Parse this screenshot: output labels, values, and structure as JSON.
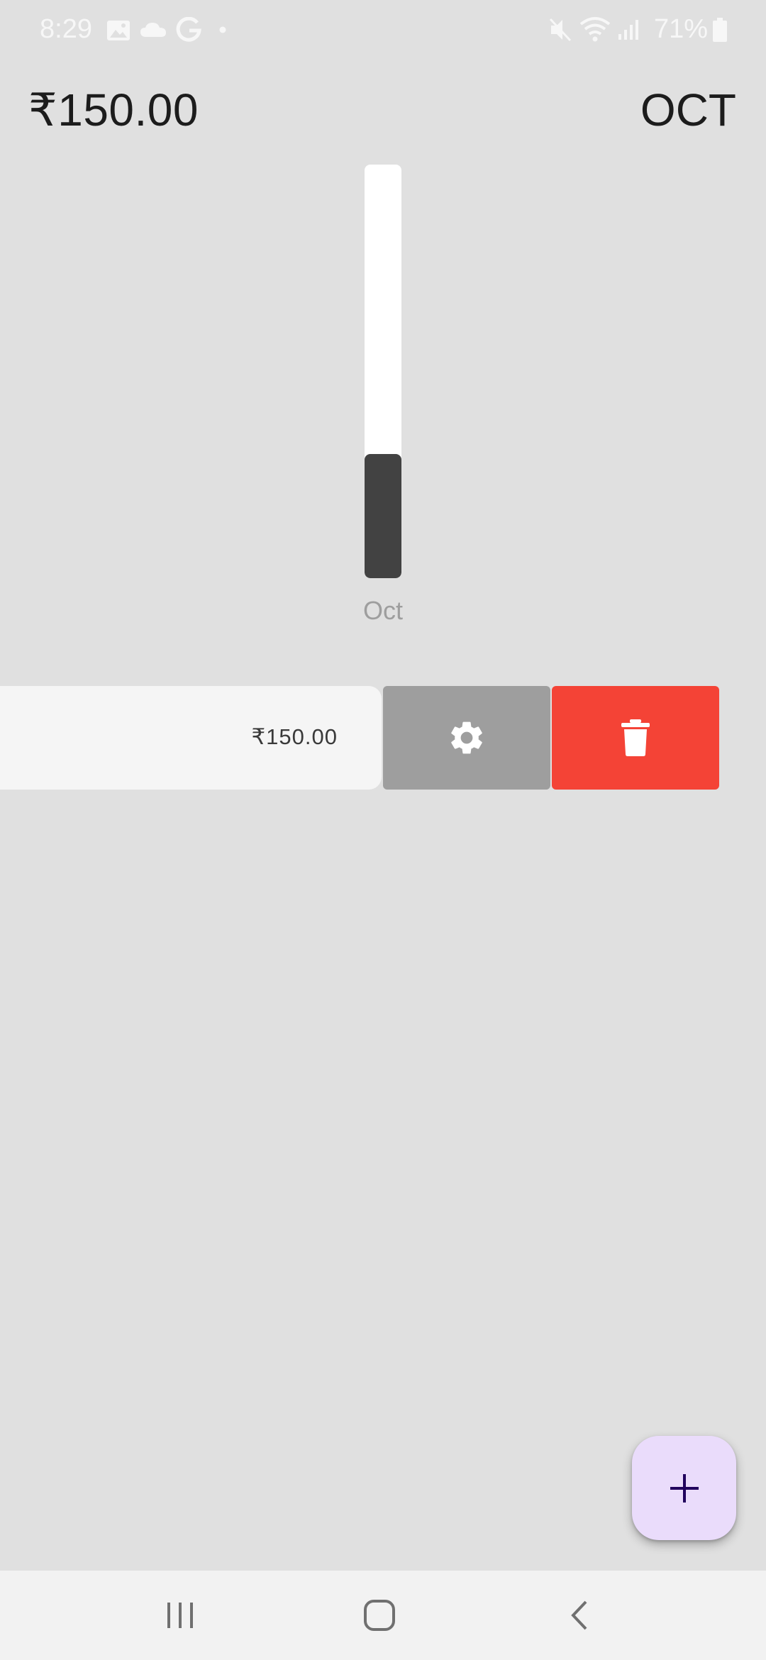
{
  "status_bar": {
    "time": "8:29",
    "battery": "71%",
    "left_icons": [
      "gallery-icon",
      "cloud-icon",
      "google-icon",
      "dot-icon"
    ],
    "right_icons": [
      "mute-icon",
      "wifi-icon",
      "signal-icon",
      "battery-icon"
    ]
  },
  "header": {
    "total": "₹150.00",
    "month": "OCT"
  },
  "chart_data": {
    "type": "bar",
    "categories": [
      "Oct"
    ],
    "values": [
      0.3
    ],
    "colors": {
      "track": "#ffffff",
      "fill": "#424242"
    }
  },
  "expense": {
    "amount": "₹150.00",
    "actions": [
      {
        "icon": "gear-icon",
        "color": "#9e9e9e"
      },
      {
        "icon": "trash-icon",
        "color": "#f44336"
      }
    ]
  },
  "fab": {
    "icon": "plus-icon",
    "color": "#eadcfb"
  },
  "nav": {
    "buttons": [
      "recents-icon",
      "home-icon",
      "back-icon"
    ]
  }
}
